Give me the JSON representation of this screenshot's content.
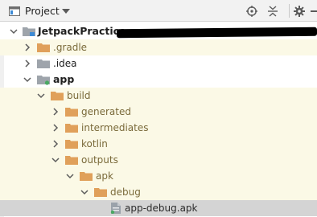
{
  "toolbar": {
    "title": "Project",
    "icons": [
      "project-view-icon",
      "dropdown-caret-icon",
      "locate-target-icon",
      "collapse-all-icon",
      "settings-gear-icon",
      "hide-panel-icon"
    ]
  },
  "colors": {
    "folder_orange": "#e0a05a",
    "folder_gray": "#9ea4ab",
    "module_dot": "#4aa862",
    "apk_icon": "#9aa2aa",
    "selection_bg": "#d4d4d4",
    "highlight_bg": "#fbf9e6"
  },
  "tree": {
    "root": {
      "label": "JetpackPractice"
    },
    "items": [
      {
        "label": ".gradle",
        "icon": "folder-orange-icon",
        "state": "collapsed"
      },
      {
        "label": ".idea",
        "icon": "folder-gray-icon",
        "state": "collapsed"
      },
      {
        "label": "app",
        "icon": "module-folder-icon",
        "state": "expanded"
      },
      {
        "label": "build",
        "icon": "folder-orange-icon",
        "state": "expanded"
      },
      {
        "label": "generated",
        "icon": "folder-orange-icon",
        "state": "collapsed"
      },
      {
        "label": "intermediates",
        "icon": "folder-orange-icon",
        "state": "collapsed"
      },
      {
        "label": "kotlin",
        "icon": "folder-orange-icon",
        "state": "collapsed"
      },
      {
        "label": "outputs",
        "icon": "folder-orange-icon",
        "state": "expanded"
      },
      {
        "label": "apk",
        "icon": "folder-orange-icon",
        "state": "expanded"
      },
      {
        "label": "debug",
        "icon": "folder-orange-icon",
        "state": "expanded"
      },
      {
        "label": "app-debug.apk",
        "icon": "apk-file-icon",
        "state": "selected"
      }
    ]
  }
}
